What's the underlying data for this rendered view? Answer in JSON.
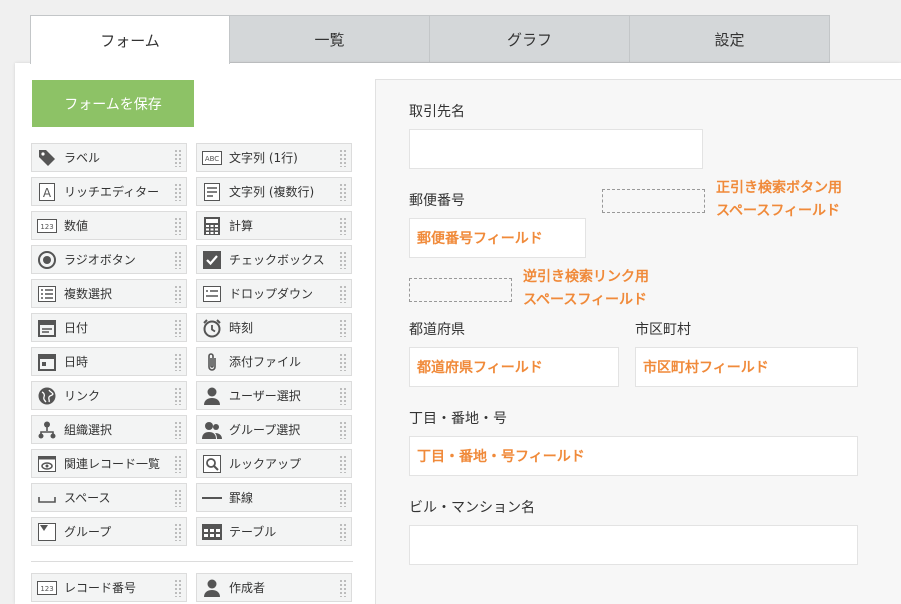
{
  "tabs": [
    "フォーム",
    "一覧",
    "グラフ",
    "設定"
  ],
  "save_button": "フォームを保存",
  "palette": {
    "items": [
      {
        "label": "ラベル",
        "icon": "tag-icon"
      },
      {
        "label": "文字列 (1行)",
        "icon": "abc-icon"
      },
      {
        "label": "リッチエディター",
        "icon": "rich-text-icon"
      },
      {
        "label": "文字列 (複数行)",
        "icon": "multiline-icon"
      },
      {
        "label": "数値",
        "icon": "number-123-icon"
      },
      {
        "label": "計算",
        "icon": "calculator-icon"
      },
      {
        "label": "ラジオボタン",
        "icon": "radio-icon"
      },
      {
        "label": "チェックボックス",
        "icon": "checkbox-icon"
      },
      {
        "label": "複数選択",
        "icon": "multi-select-icon"
      },
      {
        "label": "ドロップダウン",
        "icon": "dropdown-icon"
      },
      {
        "label": "日付",
        "icon": "calendar-icon"
      },
      {
        "label": "時刻",
        "icon": "alarm-clock-icon"
      },
      {
        "label": "日時",
        "icon": "datetime-icon"
      },
      {
        "label": "添付ファイル",
        "icon": "paperclip-icon"
      },
      {
        "label": "リンク",
        "icon": "globe-icon"
      },
      {
        "label": "ユーザー選択",
        "icon": "user-icon"
      },
      {
        "label": "組織選択",
        "icon": "org-chart-icon"
      },
      {
        "label": "グループ選択",
        "icon": "group-icon"
      },
      {
        "label": "関連レコード一覧",
        "icon": "related-records-icon"
      },
      {
        "label": "ルックアップ",
        "icon": "lookup-icon"
      },
      {
        "label": "スペース",
        "icon": "space-icon"
      },
      {
        "label": "罫線",
        "icon": "line-icon"
      },
      {
        "label": "グループ",
        "icon": "group-field-icon"
      },
      {
        "label": "テーブル",
        "icon": "table-icon"
      }
    ],
    "system_items": [
      {
        "label": "レコード番号",
        "icon": "number-123-icon"
      },
      {
        "label": "作成者",
        "icon": "user-icon"
      }
    ]
  },
  "form": {
    "client_name_label": "取引先名",
    "postal_label": "郵便番号",
    "postal_field": "郵便番号フィールド",
    "forward_search_note": [
      "正引き検索ボタン用",
      "スペースフィールド"
    ],
    "reverse_search_note": [
      "逆引き検索リンク用",
      "スペースフィールド"
    ],
    "prefecture_label": "都道府県",
    "prefecture_field": "都道府県フィールド",
    "city_label": "市区町村",
    "city_field": "市区町村フィールド",
    "street_label": "丁目・番地・号",
    "street_field": "丁目・番地・号フィールド",
    "building_label": "ビル・マンション名"
  },
  "colors": {
    "accent_orange": "#f08a3a",
    "save_green": "#8dc266"
  }
}
